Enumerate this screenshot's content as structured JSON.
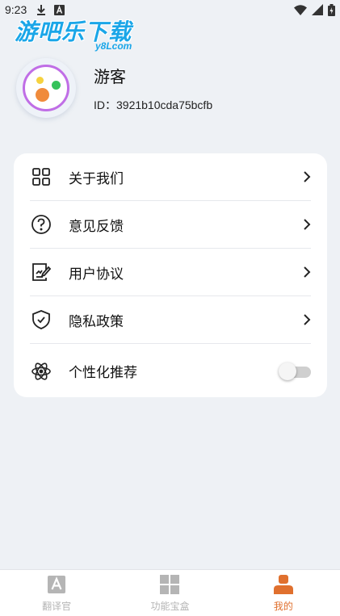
{
  "status_bar": {
    "time": "9:23",
    "left_icons": [
      "download-icon",
      "a-badge-icon"
    ],
    "right_icons": [
      "wifi-icon",
      "signal-icon",
      "battery-icon"
    ]
  },
  "watermark": {
    "title": "游吧乐下载",
    "subtitle": "y8Lcom",
    "color": "#1aa6e8"
  },
  "profile": {
    "name": "游客",
    "id_text": "ID：3921b10cda75bcfb"
  },
  "menu": {
    "items": [
      {
        "label": "关于我们",
        "icon": "grid-icon"
      },
      {
        "label": "意见反馈",
        "icon": "question-circle-icon"
      },
      {
        "label": "用户协议",
        "icon": "document-edit-icon"
      },
      {
        "label": "隐私政策",
        "icon": "shield-check-icon"
      },
      {
        "label": "个性化推荐",
        "icon": "atom-icon",
        "toggle_on": false
      }
    ]
  },
  "bottom_nav": {
    "items": [
      {
        "label": "翻译官",
        "icon": "translate-icon"
      },
      {
        "label": "功能宝盒",
        "icon": "tiles-icon"
      },
      {
        "label": "我的",
        "icon": "person-icon",
        "active": true
      }
    ],
    "active_color": "#e0702e",
    "inactive_color": "#b5b5b5"
  }
}
